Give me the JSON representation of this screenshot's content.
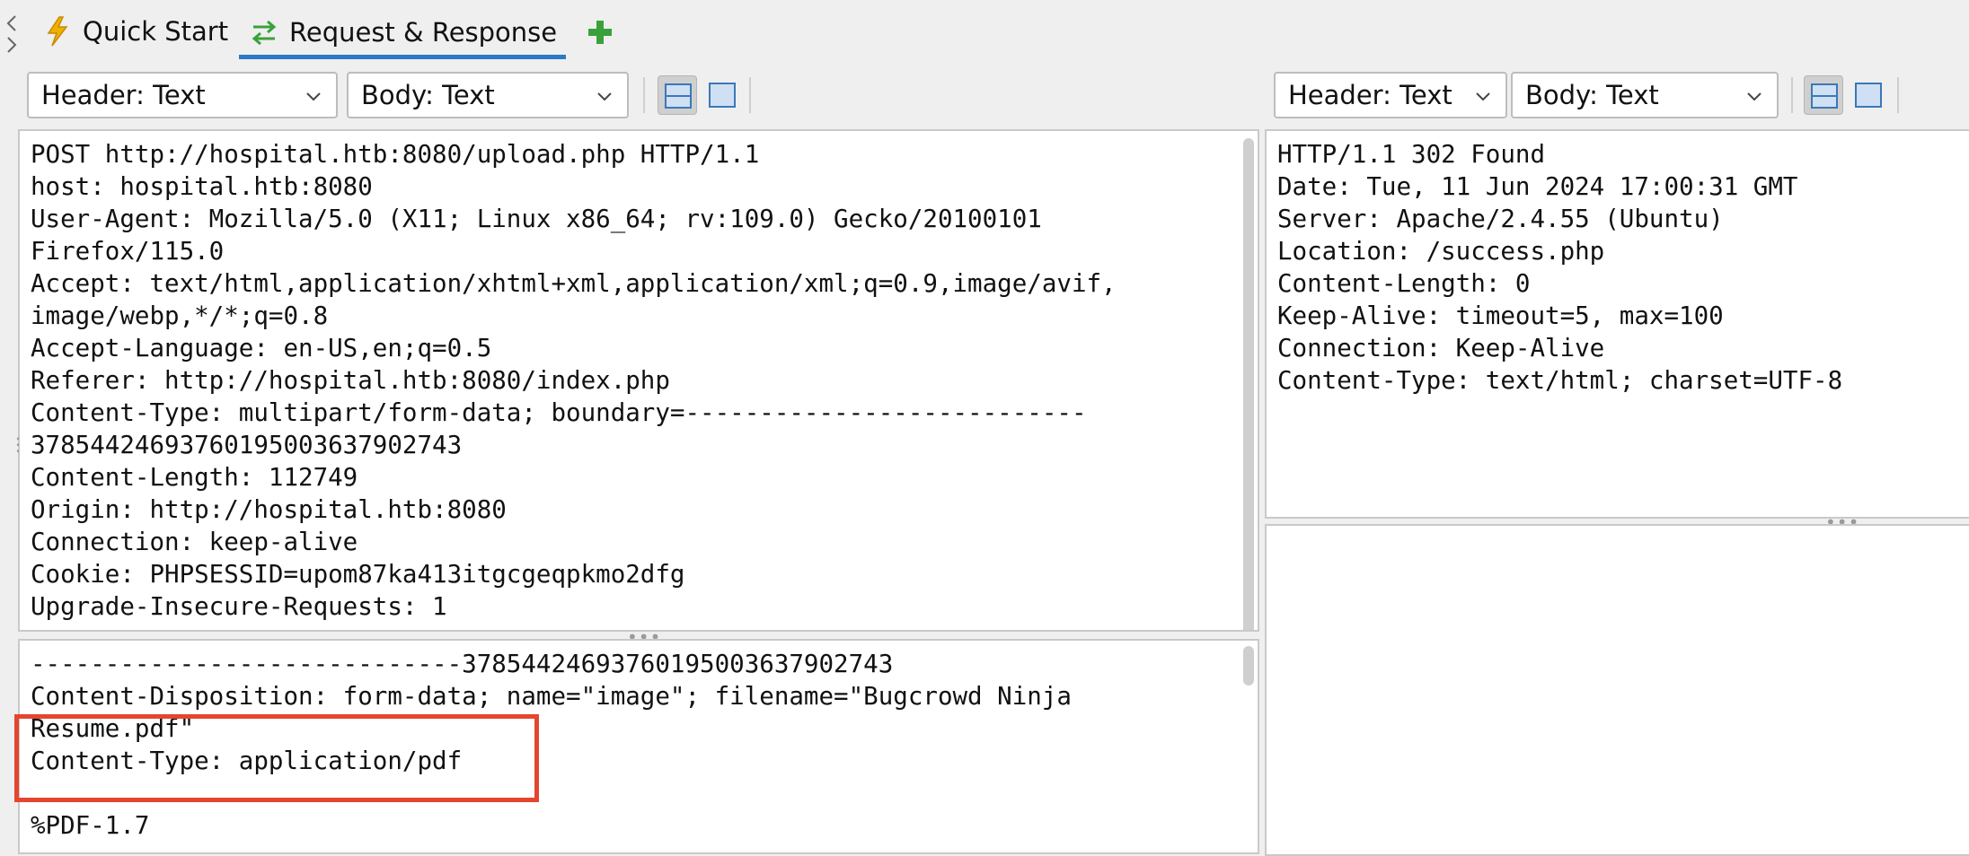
{
  "tabs": [
    {
      "label": "Quick Start",
      "icon": "lightning-icon"
    },
    {
      "label": "Request & Response",
      "icon": "exchange-arrows-icon"
    }
  ],
  "add_tab_icon": "plus-icon",
  "request": {
    "toolbar": {
      "header_select": "Header: Text",
      "body_select": "Body: Text"
    },
    "header_lines": [
      "POST http://hospital.htb:8080/upload.php HTTP/1.1",
      "host: hospital.htb:8080",
      "User-Agent: Mozilla/5.0 (X11; Linux x86_64; rv:109.0) Gecko/20100101",
      "Firefox/115.0",
      "Accept: text/html,application/xhtml+xml,application/xml;q=0.9,image/avif,",
      "image/webp,*/*;q=0.8",
      "Accept-Language: en-US,en;q=0.5",
      "Referer: http://hospital.htb:8080/index.php",
      "Content-Type: multipart/form-data; boundary=---------------------------",
      "378544246937601950036379027​43",
      "Content-Length: 112749",
      "Origin: http://hospital.htb:8080",
      "Connection: keep-alive",
      "Cookie: PHPSESSID=upom87ka413itgcgeqpkmo2dfg",
      "Upgrade-Insecure-Requests: 1"
    ],
    "body_lines": [
      "-----------------------------378544246937601950036379027​43",
      "Content-Disposition: form-data; name=\"image\"; filename=\"Bugcrowd Ninja",
      "Resume.pdf\"",
      "Content-Type: application/pdf",
      "",
      "%PDF-1.7"
    ]
  },
  "response": {
    "toolbar": {
      "header_select": "Header: Text",
      "body_select": "Body: Text"
    },
    "header_lines": [
      "HTTP/1.1 302 Found",
      "Date: Tue, 11 Jun 2024 17:00:31 GMT",
      "Server: Apache/2.4.55 (Ubuntu)",
      "Location: /success.php",
      "Content-Length: 0",
      "Keep-Alive: timeout=5, max=100",
      "Connection: Keep-Alive",
      "Content-Type: text/html; charset=UTF-8"
    ],
    "body_lines": []
  },
  "colors": {
    "active_tab_underline": "#2b7ac6",
    "highlight_box": "#e5452f",
    "plus_icon": "#3aa13a",
    "lightning_icon": "#f0b000"
  }
}
